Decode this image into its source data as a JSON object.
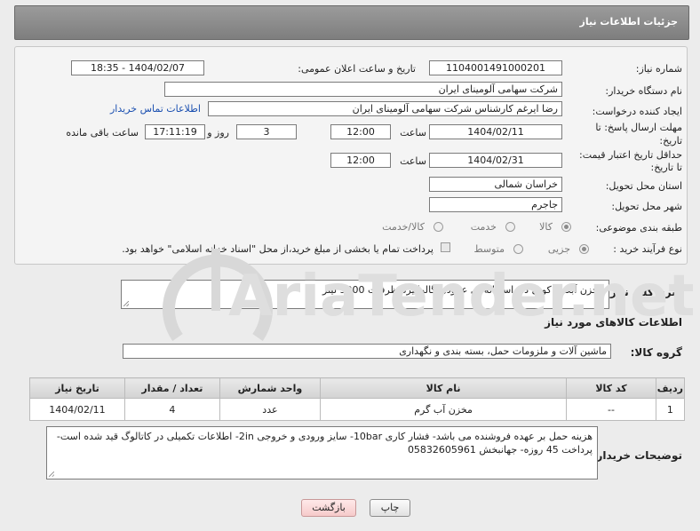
{
  "header": {
    "title": "جزئیات اطلاعات نیاز"
  },
  "form": {
    "need_number_label": "شماره نیاز:",
    "need_number": "1104001491000201",
    "announce_label": "تاریخ و ساعت اعلان عمومی:",
    "announce_value": "1404/02/07 - 18:35",
    "buyer_org_label": "نام دستگاه خریدار:",
    "buyer_org": "شرکت سهامی آلومینای ایران",
    "requester_label": "ایجاد کننده درخواست:",
    "requester": "رضا ایرغم کارشناس شرکت سهامی آلومینای ایران",
    "contact_link": "اطلاعات تماس خریدار",
    "deadline_label_1": "مهلت ارسال پاسخ: تا",
    "deadline_label_2": "تاریخ:",
    "deadline_date": "1404/02/11",
    "time_label": "ساعت",
    "deadline_time": "12:00",
    "days_value": "3",
    "days_label": "روز و",
    "remaining_time": "17:11:19",
    "remaining_label": "ساعت باقی مانده",
    "validity_label_1": "حداقل تاریخ اعتبار قیمت:",
    "validity_label_2": "تا تاریخ:",
    "validity_date": "1404/02/31",
    "validity_time": "12:00",
    "province_label": "استان محل تحویل:",
    "province": "خراسان شمالی",
    "city_label": "شهر محل تحویل:",
    "city": "جاجرم",
    "category_label": "طبقه بندی موضوعی:",
    "category_options": [
      "کالا",
      "خدمت",
      "کالا/خدمت"
    ],
    "process_label": "نوع فرآیند خرید :",
    "process_options": [
      "جزیی",
      "متوسط"
    ],
    "payment_note": "پرداخت تمام یا بخشی از مبلغ خرید،از محل \"اسناد خزانه اسلامی\" خواهد بود."
  },
  "description": {
    "label": "شرح کلی نیاز:",
    "value": "مخزن آبگرم کویل دار استوانه ای عمودی گالوانیزه ظرفیت 3000 لیتر"
  },
  "goods": {
    "section_title": "اطلاعات کالاهای مورد نیاز",
    "group_label": "گروه کالا:",
    "group_value": "ماشین آلات و ملزومات حمل، بسته بندی و نگهداری",
    "columns": [
      "ردیف",
      "کد کالا",
      "نام کالا",
      "واحد شمارش",
      "تعداد / مقدار",
      "تاریخ نیاز"
    ],
    "rows": [
      {
        "row": "1",
        "code": "--",
        "name": "مخزن آب گرم",
        "unit": "عدد",
        "qty": "4",
        "date": "1404/02/11"
      }
    ]
  },
  "buyer_notes": {
    "label": "توضیحات خریدار:",
    "value": "هزینه حمل بر عهده فروشنده می باشد- فشار کاری 10bar- سایز ورودی و خروجی 2in- اطلاعات تکمیلی در کاتالوگ قید شده است- پرداخت 45 روزه- جهانبخش 05832605961"
  },
  "buttons": {
    "print": "چاپ",
    "back": "بازگشت"
  },
  "watermark": {
    "text": "AriaTender.net"
  }
}
